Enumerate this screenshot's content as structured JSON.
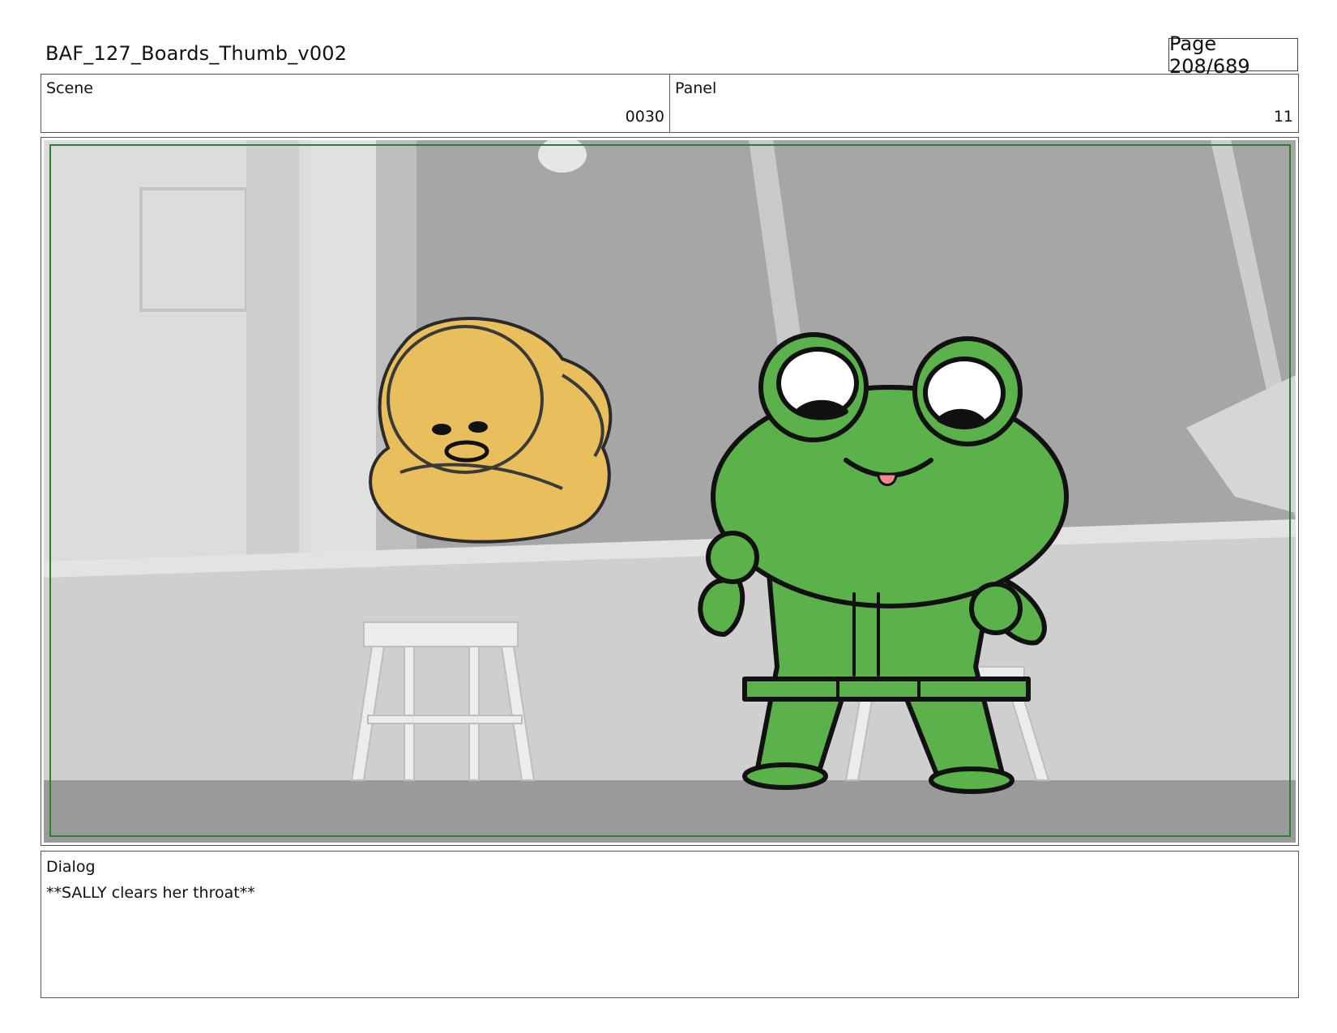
{
  "header": {
    "title": "BAF_127_Boards_Thumb_v002",
    "page": "Page 208/689"
  },
  "info": {
    "scene_label": "Scene",
    "scene_value": "0030",
    "panel_label": "Panel",
    "panel_value": "11"
  },
  "dialog": {
    "label": "Dialog",
    "text": "**SALLY clears her throat**"
  },
  "colors": {
    "frame_border": "#2e7d32",
    "frog_green": "#5bb24a",
    "duck_yellow": "#e8bf5c",
    "background_gray": "#a3a3a3"
  }
}
